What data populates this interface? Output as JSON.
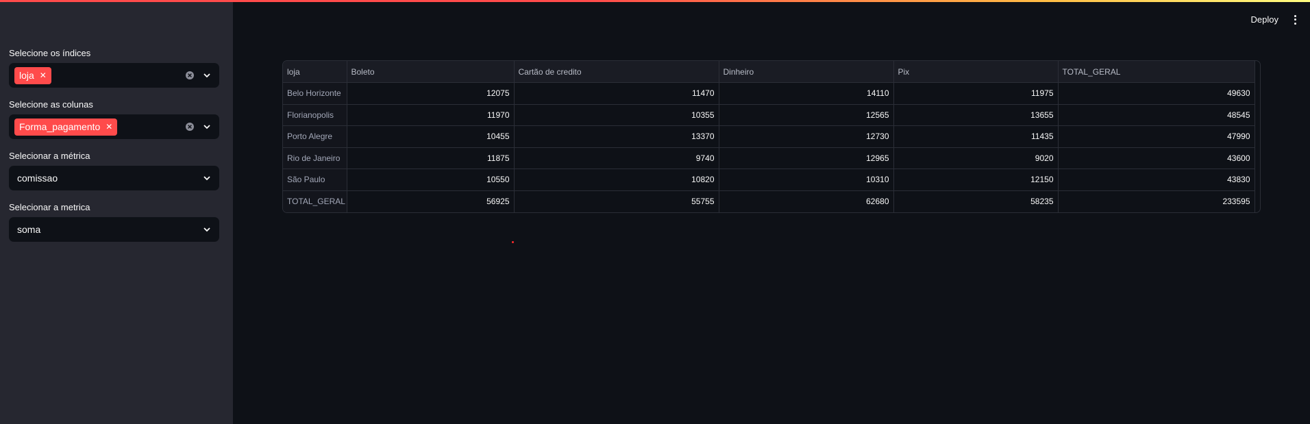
{
  "header": {
    "deploy_label": "Deploy",
    "menu_icon": "vertical-dots-icon"
  },
  "sidebar": {
    "indices": {
      "label": "Selecione os índices",
      "chips": [
        "loja"
      ]
    },
    "columns": {
      "label": "Selecione as colunas",
      "chips": [
        "Forma_pagamento"
      ]
    },
    "metric": {
      "label": "Selecionar a métrica",
      "value": "comissao"
    },
    "aggregation": {
      "label": "Selecionar a metrica",
      "value": "soma"
    }
  },
  "table": {
    "columns": [
      "loja",
      "Boleto",
      "Cartão de credito",
      "Dinheiro",
      "Pix",
      "TOTAL_GERAL"
    ],
    "rows": [
      [
        "Belo Horizonte",
        "12075",
        "11470",
        "14110",
        "11975",
        "49630"
      ],
      [
        "Florianopolis",
        "11970",
        "10355",
        "12565",
        "13655",
        "48545"
      ],
      [
        "Porto Alegre",
        "10455",
        "13370",
        "12730",
        "11435",
        "47990"
      ],
      [
        "Rio de Janeiro",
        "11875",
        "9740",
        "12965",
        "9020",
        "43600"
      ],
      [
        "São Paulo",
        "10550",
        "10820",
        "10310",
        "12150",
        "43830"
      ],
      [
        "TOTAL_GERAL",
        "56925",
        "55755",
        "62680",
        "58235",
        "233595"
      ]
    ]
  },
  "colors": {
    "accent": "#ff4b4b",
    "background": "#0e1117",
    "sidebar": "#262730"
  }
}
